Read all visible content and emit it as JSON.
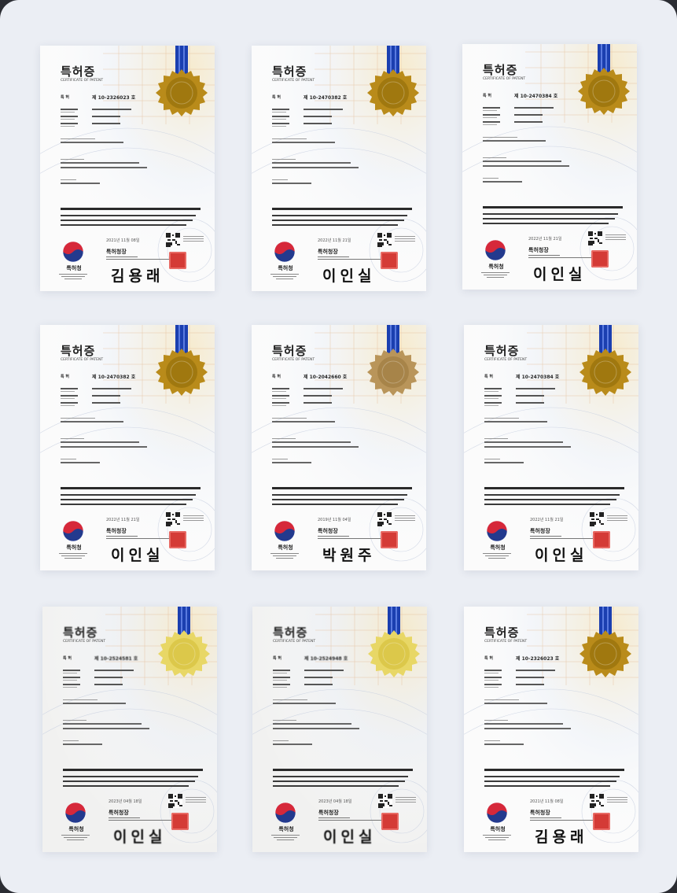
{
  "certificates": [
    {
      "title": "특허증",
      "subtitle": "CERTIFICATE OF PATENT",
      "number_label": "특 허",
      "number": "제 10-2326023 호",
      "date": "2021년 11월 08일",
      "office": "특허청",
      "chief": "특허청장",
      "signature": "김용래",
      "seal": "gold"
    },
    {
      "title": "특허증",
      "subtitle": "CERTIFICATE OF PATENT",
      "number_label": "특 허",
      "number": "제 10-2470382 호",
      "date": "2022년 11월 21일",
      "office": "특허청",
      "chief": "특허청장",
      "signature": "이인실",
      "seal": "gold"
    },
    {
      "title": "특허증",
      "subtitle": "CERTIFICATE OF PATENT",
      "number_label": "특 허",
      "number": "제 10-2470384 호",
      "date": "2022년 11월 21일",
      "office": "특허청",
      "chief": "특허청장",
      "signature": "이인실",
      "seal": "gold"
    },
    {
      "title": "특허증",
      "subtitle": "CERTIFICATE OF PATENT",
      "number_label": "특 허",
      "number": "제 10-2470382 호",
      "date": "2022년 11월 21일",
      "office": "특허청",
      "chief": "특허청장",
      "signature": "이인실",
      "seal": "gold"
    },
    {
      "title": "특허증",
      "subtitle": "CERTIFICATE OF PATENT",
      "number_label": "특 허",
      "number": "제 10-2042660 호",
      "date": "2019년 11월 04일",
      "office": "특허청",
      "chief": "특허청장",
      "signature": "박원주",
      "seal": "bronze"
    },
    {
      "title": "특허증",
      "subtitle": "CERTIFICATE OF PATENT",
      "number_label": "특 허",
      "number": "제 10-2470384 호",
      "date": "2022년 11월 21일",
      "office": "특허청",
      "chief": "특허청장",
      "signature": "이인실",
      "seal": "gold"
    },
    {
      "title": "특허증",
      "subtitle": "CERTIFICATE OF PATENT",
      "number_label": "특 허",
      "number": "제 10-2524581 호",
      "date": "2023년 04월 18일",
      "office": "특허청",
      "chief": "특허청장",
      "signature": "이인실",
      "seal": "light"
    },
    {
      "title": "특허증",
      "subtitle": "CERTIFICATE OF PATENT",
      "number_label": "특 허",
      "number": "제 10-2524948 호",
      "date": "2023년 04월 18일",
      "office": "특허청",
      "chief": "특허청장",
      "signature": "이인실",
      "seal": "light"
    },
    {
      "title": "특허증",
      "subtitle": "CERTIFICATE OF PATENT",
      "number_label": "특 허",
      "number": "제 10-2326023 호",
      "date": "2021년 11월 08일",
      "office": "특허청",
      "chief": "특허청장",
      "signature": "김용래",
      "seal": "gold"
    }
  ],
  "colors": {
    "background": "#ebeef4",
    "ribbon": "#1b3fb0",
    "seal_gold": "#b8860b",
    "stamp": "#d43b36",
    "kipo_red": "#d6283a",
    "kipo_blue": "#233a8e"
  }
}
